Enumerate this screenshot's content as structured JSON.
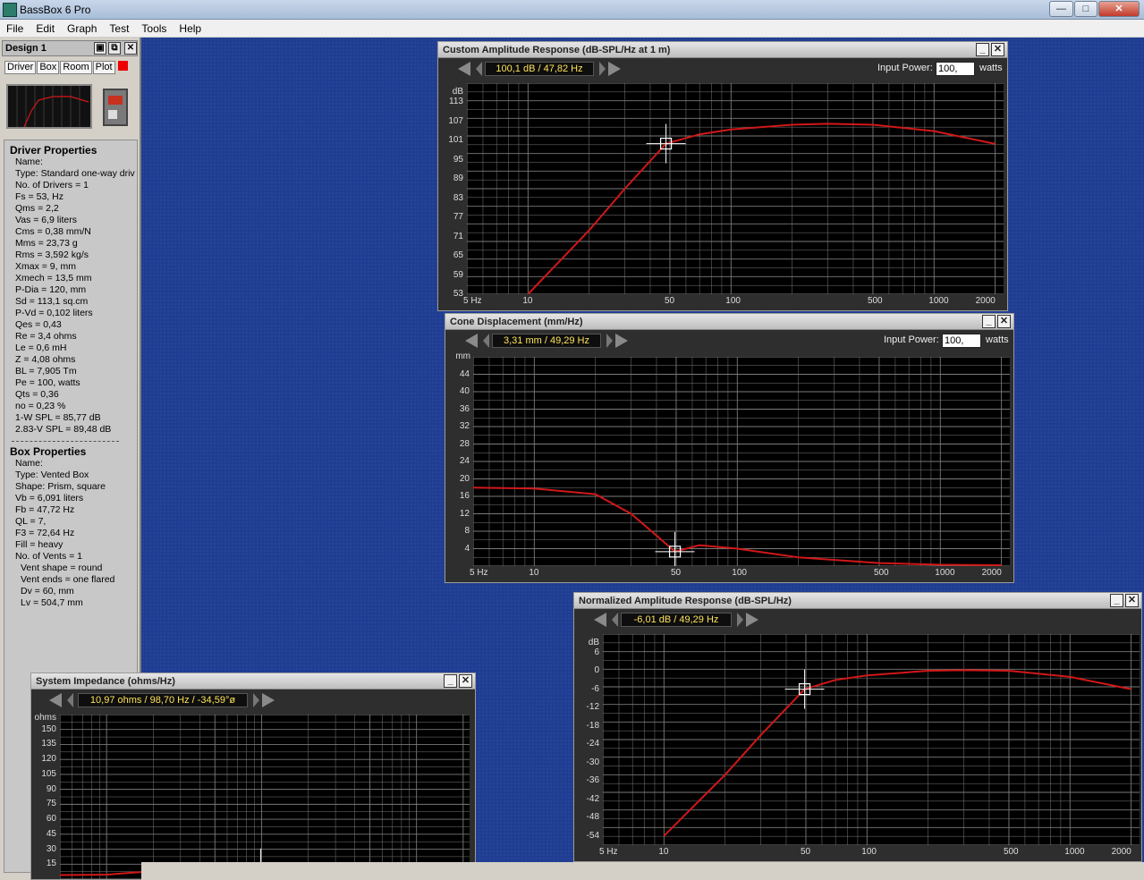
{
  "app": {
    "title": "BassBox 6 Pro",
    "min": "—",
    "max": "□",
    "close": "✕"
  },
  "menu": [
    "File",
    "Edit",
    "Graph",
    "Test",
    "Tools",
    "Help"
  ],
  "panel": {
    "title": "Design 1",
    "tabs": [
      "Driver",
      "Box",
      "Room",
      "Plot"
    ],
    "driver_heading": "Driver Properties",
    "driver": [
      "Name:",
      "Type: Standard one-way driv",
      "No. of Drivers = 1",
      "Fs = 53, Hz",
      "Qms = 2,2",
      "Vas = 6,9 liters",
      "Cms = 0,38 mm/N",
      "Mms = 23,73 g",
      "Rms = 3,592 kg/s",
      "Xmax = 9, mm",
      "Xmech = 13,5 mm",
      "P-Dia = 120, mm",
      "Sd = 113,1 sq.cm",
      "P-Vd = 0,102 liters",
      "Qes = 0,43",
      "Re = 3,4 ohms",
      "Le = 0,6 mH",
      "Z = 4,08 ohms",
      "BL = 7,905 Tm",
      "Pe = 100, watts",
      "Qts = 0,36",
      "no = 0,23 %",
      "1-W SPL = 85,77 dB",
      "2.83-V SPL = 89,48 dB"
    ],
    "box_heading": "Box Properties",
    "box": [
      "Name:",
      "Type: Vented Box",
      "Shape: Prism, square",
      "Vb = 6,091 liters",
      "Fb = 47,72 Hz",
      "QL = 7,",
      "F3 = 72,64 Hz",
      "Fill = heavy",
      "No. of Vents = 1"
    ],
    "vent": [
      "Vent shape = round",
      "Vent ends = one flared",
      "Dv = 60, mm",
      "Lv = 504,7 mm"
    ]
  },
  "graphs": {
    "custom": {
      "title": "Custom Amplitude Response (dB-SPL/Hz at 1 m)",
      "readout": "100,1 dB / 47,82 Hz",
      "input_label": "Input Power:",
      "input_value": "100,",
      "input_unit": "watts",
      "unit": "dB",
      "yticks": [
        "113",
        "107",
        "101",
        "95",
        "89",
        "83",
        "77",
        "71",
        "65",
        "59",
        "53"
      ],
      "xticks": [
        "5 Hz",
        "10",
        "50",
        "100",
        "500",
        "1000",
        "2000"
      ]
    },
    "cone": {
      "title": "Cone Displacement (mm/Hz)",
      "readout": "3,31 mm / 49,29 Hz",
      "input_label": "Input Power:",
      "input_value": "100,",
      "input_unit": "watts",
      "unit": "mm",
      "yticks": [
        "44",
        "40",
        "36",
        "32",
        "28",
        "24",
        "20",
        "16",
        "12",
        "8",
        "4"
      ],
      "xticks": [
        "5 Hz",
        "10",
        "50",
        "100",
        "500",
        "1000",
        "2000"
      ]
    },
    "normalized": {
      "title": "Normalized Amplitude Response (dB-SPL/Hz)",
      "readout": "-6,01 dB / 49,29 Hz",
      "unit": "dB",
      "yticks": [
        "6",
        "0",
        "-6",
        "-12",
        "-18",
        "-24",
        "-30",
        "-36",
        "-42",
        "-48",
        "-54"
      ],
      "xticks": [
        "5 Hz",
        "10",
        "50",
        "100",
        "500",
        "1000",
        "2000"
      ]
    },
    "impedance": {
      "title": "System Impedance (ohms/Hz)",
      "readout": "10,97 ohms / 98,70 Hz / -34,59°ø",
      "unit": "ohms",
      "yticks": [
        "150",
        "135",
        "120",
        "105",
        "90",
        "75",
        "60",
        "45",
        "30",
        "15"
      ]
    }
  },
  "colors": {
    "curve": "#d01818",
    "grid": "#7a7a7a",
    "readout_text": "#ffe35a"
  },
  "chart_data": [
    {
      "type": "line",
      "name": "custom",
      "x": [
        10,
        20,
        30,
        47.82,
        70,
        100,
        200,
        300,
        500,
        1000,
        2000
      ],
      "y": [
        53,
        73,
        86,
        100.1,
        103,
        104.5,
        106,
        106.3,
        106,
        104,
        100
      ],
      "ylim": [
        53,
        119
      ],
      "xlim": [
        5,
        2200
      ],
      "xscale": "log"
    },
    {
      "type": "line",
      "name": "cone",
      "x": [
        5,
        10,
        20,
        30,
        40,
        49.29,
        65,
        100,
        200,
        500,
        1000,
        2000
      ],
      "y": [
        18,
        17.8,
        16.5,
        12,
        7,
        3.31,
        4.8,
        4,
        2,
        0.7,
        0.3,
        0.2
      ],
      "ylim": [
        0,
        48
      ],
      "xlim": [
        5,
        2200
      ],
      "xscale": "log"
    },
    {
      "type": "line",
      "name": "normalized",
      "x": [
        10,
        20,
        30,
        49.29,
        70,
        100,
        200,
        300,
        500,
        1000,
        2000
      ],
      "y": [
        -54,
        -34,
        -21,
        -6.01,
        -3,
        -1.5,
        0,
        0.2,
        0,
        -2,
        -6
      ],
      "ylim": [
        -57,
        12
      ],
      "xlim": [
        5,
        2200
      ],
      "xscale": "log"
    },
    {
      "type": "line",
      "name": "impedance",
      "x": [
        5,
        10,
        20,
        30,
        40,
        47.82,
        55,
        70,
        98.7,
        150,
        300,
        1000,
        2000
      ],
      "y": [
        4,
        4.5,
        8,
        15,
        6,
        5,
        8,
        14,
        10.97,
        5,
        4,
        5,
        8
      ],
      "ylim": [
        0,
        165
      ],
      "xlim": [
        5,
        2200
      ],
      "xscale": "log"
    }
  ]
}
